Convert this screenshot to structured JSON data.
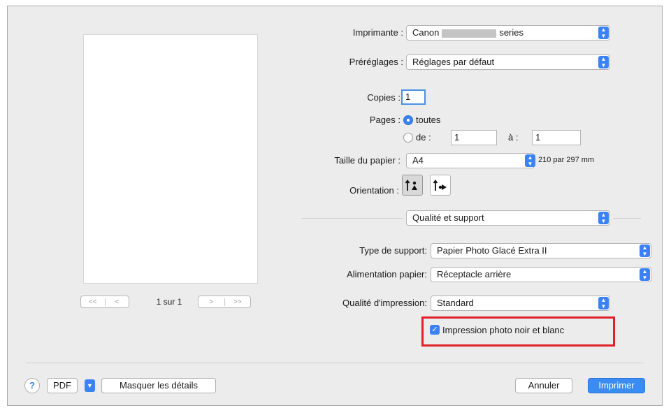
{
  "preview": {
    "page_indicator": "1 sur 1",
    "nav_left": [
      "<<",
      "<"
    ],
    "nav_right": [
      ">",
      ">>"
    ]
  },
  "printer": {
    "label": "Imprimante :",
    "value_prefix": "Canon",
    "value_suffix": "series"
  },
  "presets": {
    "label": "Préréglages :",
    "value": "Réglages par défaut"
  },
  "copies": {
    "label": "Copies :",
    "value": "1"
  },
  "pages": {
    "label": "Pages :",
    "all_label": "toutes",
    "from_label": "de :",
    "from_value": "1",
    "to_label": "à :",
    "to_value": "1",
    "selected": "toutes"
  },
  "paper_size": {
    "label": "Taille du papier :",
    "value": "A4",
    "dimensions": "210 par 297 mm"
  },
  "orientation": {
    "label": "Orientation :",
    "selected": "portrait"
  },
  "panel_select": {
    "value": "Qualité et support"
  },
  "media_type": {
    "label": "Type de support:",
    "value": "Papier Photo Glacé Extra II"
  },
  "paper_source": {
    "label": "Alimentation papier:",
    "value": "Réceptacle arrière"
  },
  "print_quality": {
    "label": "Qualité d'impression:",
    "value": "Standard"
  },
  "grayscale": {
    "label": "Impression photo noir et blanc",
    "checked": true
  },
  "footer": {
    "help": "?",
    "pdf": "PDF",
    "hide_details": "Masquer les détails",
    "cancel": "Annuler",
    "print": "Imprimer"
  },
  "colors": {
    "accent": "#3b82f6",
    "highlight": "#e0202a",
    "dialog_bg": "#ececec"
  }
}
